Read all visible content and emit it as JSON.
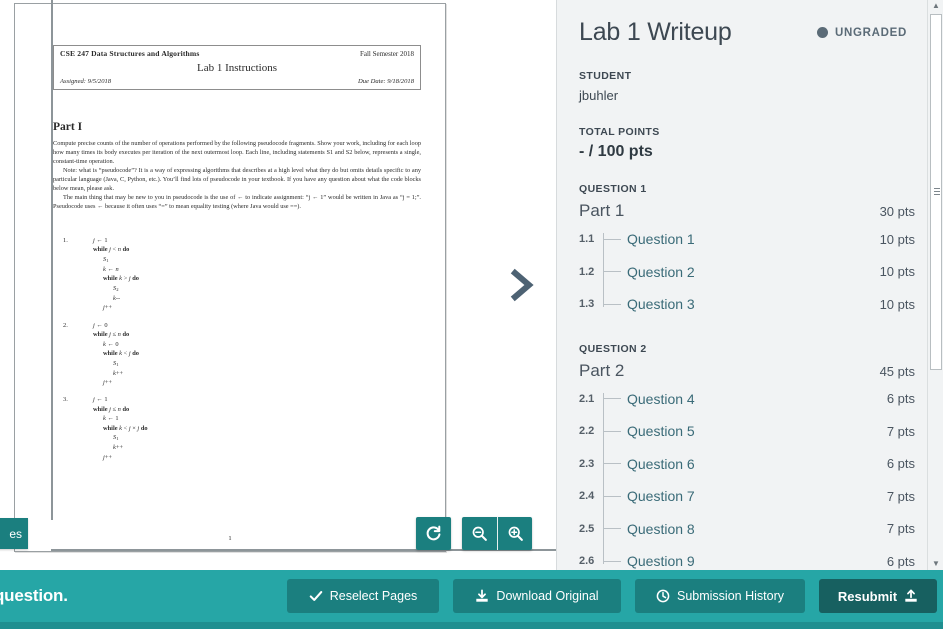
{
  "document": {
    "header": {
      "course": "CSE 247 Data Structures and Algorithms",
      "semester": "Fall Semester 2018",
      "title": "Lab 1 Instructions",
      "assigned": "Assigned: 9/5/2018",
      "due": "Due Date: 9/18/2018"
    },
    "part_title": "Part I",
    "paragraphs": [
      "Compute precise counts of the number of operations performed by the following pseudocode fragments. Show your work, including for each loop how many times its body executes per iteration of the next outermost loop. Each line, including statements S1 and S2 below, represents a single, constant-time operation.",
      "Note: what is “pseudocode”? It is a way of expressing algorithms that describes at a high level what they do but omits details specific to any particular language (Java, C, Python, etc.). You’ll find lots of pseudocode in your textbook. If you have any question about what the code blocks below mean, please ask.",
      "The main thing that may be new to you in pseudocode is the use of ← to indicate assignment: “j ← 1” would be written in Java as “j = 1;”. Pseudocode uses ← because it often uses “=” to mean equality testing (where Java would use ==)."
    ],
    "code_blocks": [
      {
        "number": "1.",
        "lines": [
          {
            "indent": 0,
            "text": "j ← 1"
          },
          {
            "indent": 0,
            "text": "while j < n do"
          },
          {
            "indent": 1,
            "text": "S1"
          },
          {
            "indent": 1,
            "text": "k ← n"
          },
          {
            "indent": 1,
            "text": "while k > j do"
          },
          {
            "indent": 2,
            "text": "S2"
          },
          {
            "indent": 2,
            "text": "k--"
          },
          {
            "indent": 1,
            "text": "j++"
          }
        ]
      },
      {
        "number": "2.",
        "lines": [
          {
            "indent": 0,
            "text": "j ← 0"
          },
          {
            "indent": 0,
            "text": "while j ≤ n do"
          },
          {
            "indent": 1,
            "text": "k ← 0"
          },
          {
            "indent": 1,
            "text": "while k < j do"
          },
          {
            "indent": 2,
            "text": "S1"
          },
          {
            "indent": 2,
            "text": "k++"
          },
          {
            "indent": 1,
            "text": "j++"
          }
        ]
      },
      {
        "number": "3.",
        "lines": [
          {
            "indent": 0,
            "text": "j ← 1"
          },
          {
            "indent": 0,
            "text": "while j ≤ n do"
          },
          {
            "indent": 1,
            "text": "k ← 1"
          },
          {
            "indent": 1,
            "text": "while k < j × j do"
          },
          {
            "indent": 2,
            "text": "S1"
          },
          {
            "indent": 2,
            "text": "k++"
          },
          {
            "indent": 1,
            "text": "j++"
          }
        ]
      }
    ],
    "page_number": "1"
  },
  "viewer_controls": {
    "rotate_icon": "rotate-cw-icon",
    "zoom_out_icon": "zoom-out-icon",
    "zoom_in_icon": "zoom-in-icon",
    "next_page_icon": "chevron-right-icon"
  },
  "left_cut_button": {
    "label": "es"
  },
  "sidebar": {
    "title": "Lab 1 Writeup",
    "status": "UNGRADED",
    "status_color": "#5b6b77",
    "student_label": "STUDENT",
    "student_name": "jbuhler",
    "total_points_label": "TOTAL POINTS",
    "total_points_value": "- / 100 pts",
    "groups": [
      {
        "group_label": "QUESTION 1",
        "parent_name": "Part 1",
        "parent_points": "30 pts",
        "children": [
          {
            "index": "1.1",
            "name": "Question 1",
            "points": "10 pts"
          },
          {
            "index": "1.2",
            "name": "Question 2",
            "points": "10 pts"
          },
          {
            "index": "1.3",
            "name": "Question 3",
            "points": "10 pts"
          }
        ]
      },
      {
        "group_label": "QUESTION 2",
        "parent_name": "Part 2",
        "parent_points": "45 pts",
        "children": [
          {
            "index": "2.1",
            "name": "Question 4",
            "points": "6 pts"
          },
          {
            "index": "2.2",
            "name": "Question 5",
            "points": "7 pts"
          },
          {
            "index": "2.3",
            "name": "Question 6",
            "points": "6 pts"
          },
          {
            "index": "2.4",
            "name": "Question 7",
            "points": "7 pts"
          },
          {
            "index": "2.5",
            "name": "Question 8",
            "points": "7 pts"
          },
          {
            "index": "2.6",
            "name": "Question 9",
            "points": "6 pts"
          }
        ]
      }
    ]
  },
  "footer": {
    "left_text": "question.",
    "background_color": "#26a6a6",
    "buttons": [
      {
        "label": "Reselect Pages",
        "icon": "check-icon"
      },
      {
        "label": "Download Original",
        "icon": "download-icon"
      },
      {
        "label": "Submission History",
        "icon": "clock-icon"
      },
      {
        "label": "Resubmit",
        "icon": "upload-icon"
      }
    ]
  }
}
